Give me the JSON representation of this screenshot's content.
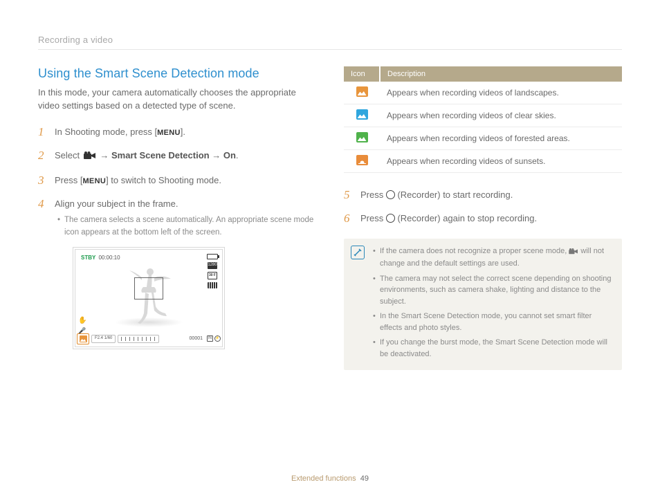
{
  "breadcrumb": "Recording a video",
  "title": "Using the Smart Scene Detection mode",
  "intro": "In this mode, your camera automatically chooses the appropriate video settings based on a detected type of scene.",
  "steps": {
    "s1_a": "In Shooting mode, press [",
    "s1_menu": "MENU",
    "s1_b": "].",
    "s2_a": "Select ",
    "s2_b": " → ",
    "s2_c": "Smart Scene Detection",
    "s2_d": " → ",
    "s2_e": "On",
    "s2_f": ".",
    "s3_a": "Press [",
    "s3_menu": "MENU",
    "s3_b": "] to switch to Shooting mode.",
    "s4": "Align your subject in the frame.",
    "s4_sub": "The camera selects a scene automatically. An appropriate scene mode icon appears at the bottom left of the screen.",
    "s5_a": "Press ",
    "s5_b": " (Recorder) to start recording.",
    "s6_a": "Press ",
    "s6_b": " (Recorder) again to stop recording."
  },
  "step_numbers": {
    "n1": "1",
    "n2": "2",
    "n3": "3",
    "n4": "4",
    "n5": "5",
    "n6": "6"
  },
  "screen": {
    "stby": "STBY",
    "time": "00:00:10",
    "res_label": "1280",
    "sf_label": "30 F",
    "aperture": "F2.4",
    "shutter": "1/60",
    "counter": "00001"
  },
  "table": {
    "head_icon": "Icon",
    "head_desc": "Description",
    "rows": [
      {
        "icon": "landscape",
        "desc": "Appears when recording videos of landscapes."
      },
      {
        "icon": "sky",
        "desc": "Appears when recording videos of clear skies."
      },
      {
        "icon": "forest",
        "desc": "Appears when recording videos of forested areas."
      },
      {
        "icon": "sunset",
        "desc": "Appears when recording videos of sunsets."
      }
    ]
  },
  "notes": {
    "n1_a": "If the camera does not recognize a proper scene mode, ",
    "n1_b": " will not change and the default settings are used.",
    "n2": "The camera may not select the correct scene depending on shooting environments, such as camera shake, lighting and distance to the subject.",
    "n3": "In the Smart Scene Detection mode, you cannot set smart filter effects and photo styles.",
    "n4": "If you change the burst mode, the Smart Scene Detection mode will be deactivated."
  },
  "footer": {
    "section": "Extended functions",
    "page": "49"
  }
}
